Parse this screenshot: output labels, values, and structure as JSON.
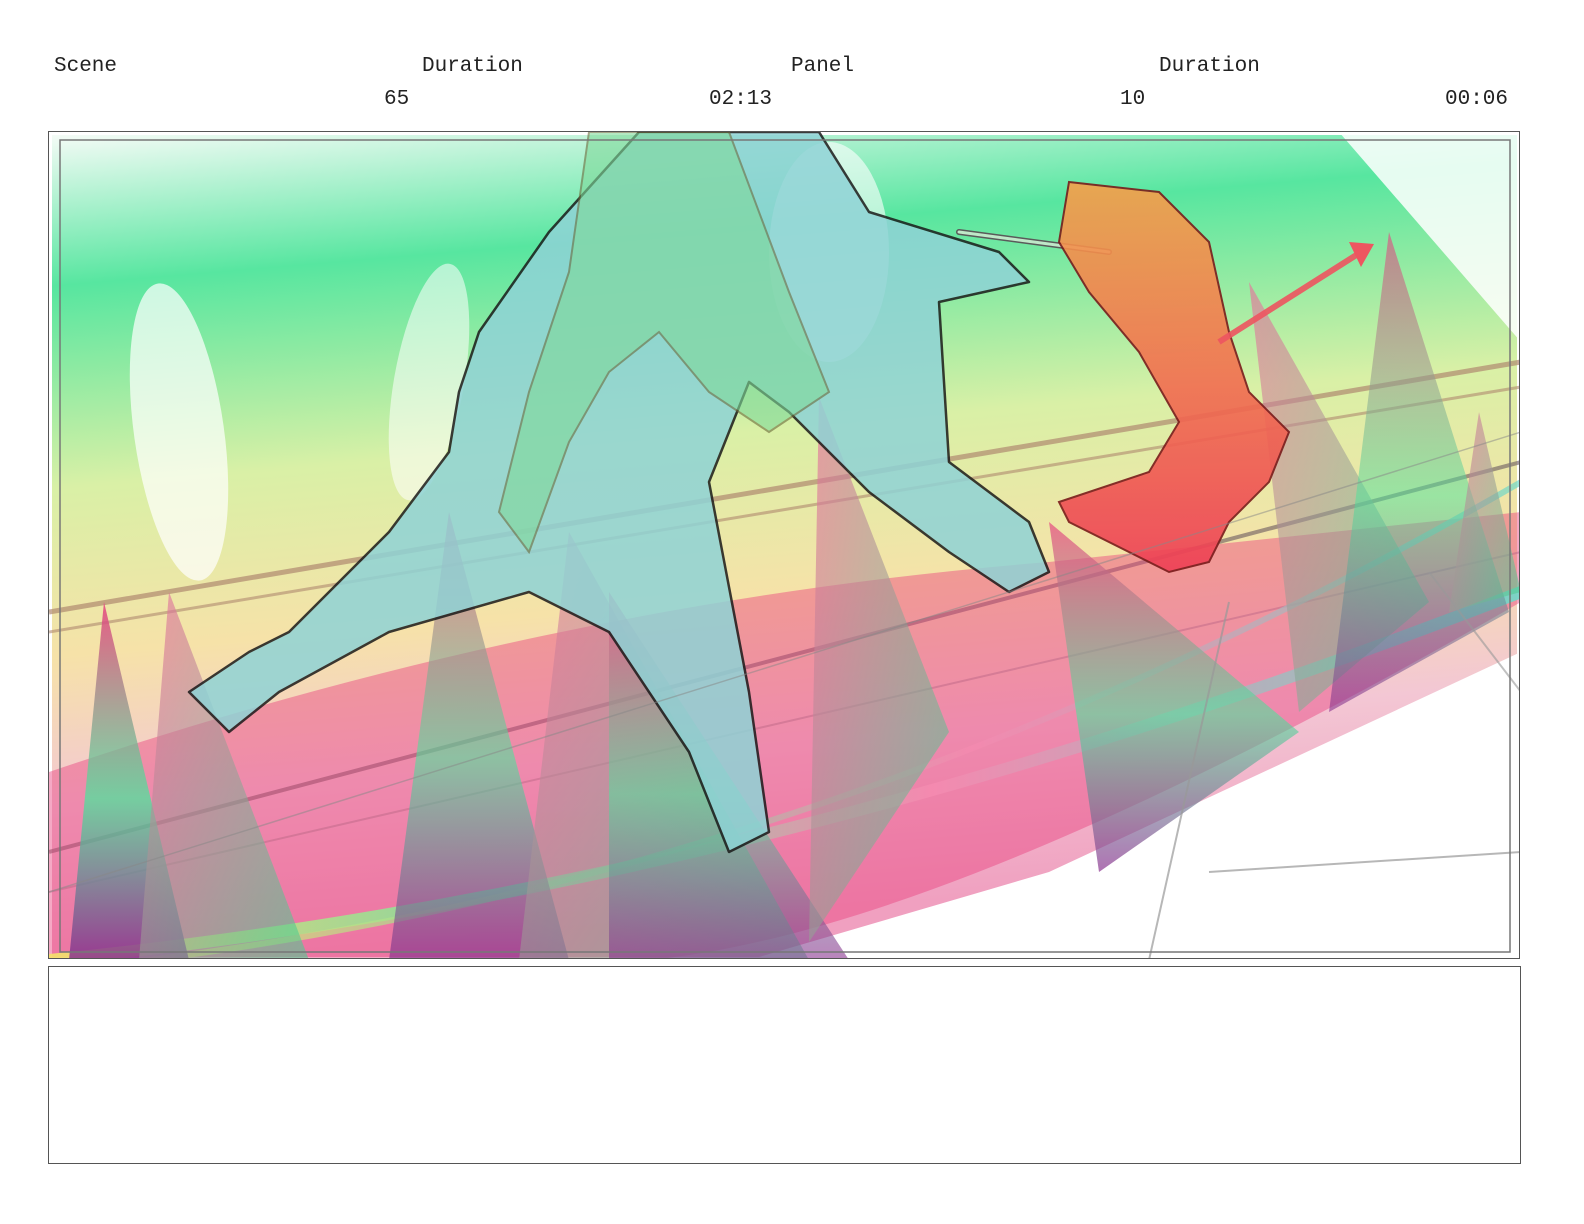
{
  "header": {
    "scene_label": "Scene",
    "scene_duration_label": "Duration",
    "panel_label": "Panel",
    "panel_duration_label": "Duration",
    "scene_value": "65",
    "scene_duration_value": "02:13",
    "panel_value": "10",
    "panel_duration_value": "00:06"
  },
  "artwork": {
    "subject": "storyboard sketch: large cyan silhouette figure lunging with sword toward red kneeling figure on rainbow-edged platform with pink and green triangular energy spikes",
    "colors": {
      "cyan": "#8fd3d6",
      "green": "#4ee39c",
      "yellow": "#f2e6a0",
      "pink": "#e8417f",
      "red": "#ee3f55",
      "orange": "#f28a3a",
      "purple": "#8a2f8e"
    }
  },
  "notes": {
    "text": ""
  }
}
